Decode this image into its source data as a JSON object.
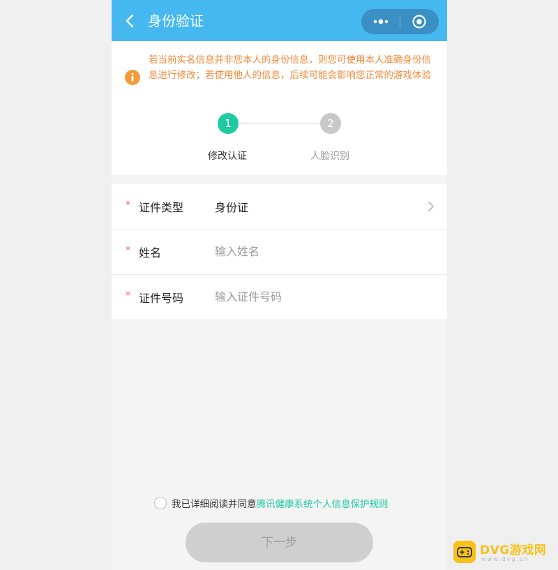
{
  "header": {
    "title": "身份验证",
    "bg_color": "#45b8f0",
    "back_icon": "chevron-left-icon",
    "more_icon": "more-dots-icon",
    "close_icon": "target-circle-icon"
  },
  "notice": {
    "text": "若当前实名信息并非您本人的身份信息，则您可使用本人准确身份信息进行修改；若使用他人的信息，后续可能会影响您正常的游戏体验",
    "icon": "info-warning-icon",
    "text_color": "#f08a3c"
  },
  "steps": [
    {
      "number": "1",
      "label": "修改认证",
      "active": true
    },
    {
      "number": "2",
      "label": "人脸识别",
      "active": false
    }
  ],
  "form": {
    "id_type": {
      "label": "证件类型",
      "value": "身份证"
    },
    "name": {
      "label": "姓名",
      "placeholder": "输入姓名",
      "value": ""
    },
    "id_number": {
      "label": "证件号码",
      "placeholder": "输入证件号码",
      "value": ""
    },
    "required_mark": "*"
  },
  "agreement": {
    "prefix": "我已详细阅读并同意",
    "link": "腾讯健康系统个人信息保护规则",
    "checked": false,
    "link_color": "#1fcb9e"
  },
  "next_button": {
    "label": "下一步"
  },
  "watermark": {
    "text": "DVG游戏网",
    "sub": "www.dvg.cn"
  }
}
